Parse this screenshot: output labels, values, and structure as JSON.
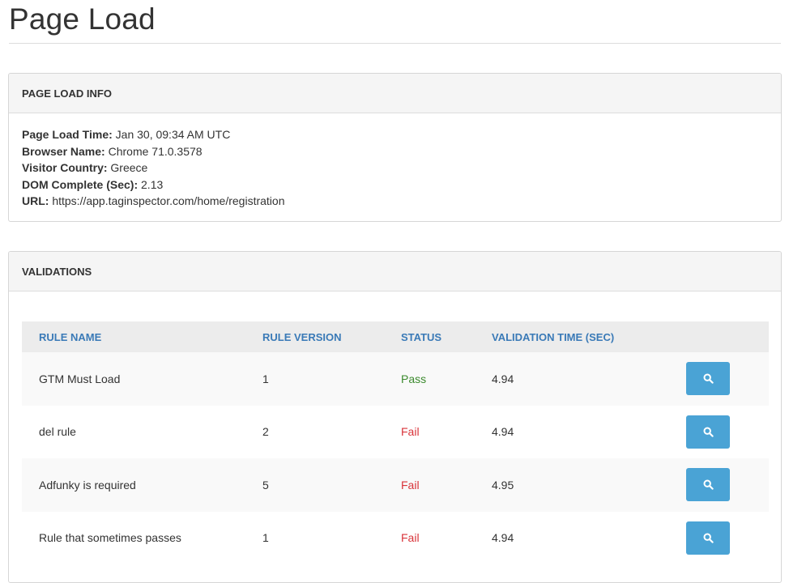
{
  "page": {
    "title": "Page Load"
  },
  "info_panel": {
    "heading": "PAGE LOAD INFO",
    "rows": [
      {
        "label": "Page Load Time:",
        "value": "Jan 30, 09:34 AM UTC"
      },
      {
        "label": "Browser Name:",
        "value": "Chrome 71.0.3578"
      },
      {
        "label": "Visitor Country:",
        "value": "Greece"
      },
      {
        "label": "DOM Complete (Sec):",
        "value": "2.13"
      },
      {
        "label": "URL:",
        "value": "https://app.taginspector.com/home/registration"
      }
    ]
  },
  "validations": {
    "heading": "VALIDATIONS",
    "columns": [
      "RULE NAME",
      "RULE VERSION",
      "STATUS",
      "VALIDATION TIME (SEC)"
    ],
    "rows": [
      {
        "rule_name": "GTM Must Load",
        "rule_version": "1",
        "status": "Pass",
        "validation_time": "4.94",
        "action_icon": "search-icon"
      },
      {
        "rule_name": "del rule",
        "rule_version": "2",
        "status": "Fail",
        "validation_time": "4.94",
        "action_icon": "search-icon"
      },
      {
        "rule_name": "Adfunky is required",
        "rule_version": "5",
        "status": "Fail",
        "validation_time": "4.95",
        "action_icon": "search-icon"
      },
      {
        "rule_name": "Rule that sometimes passes",
        "rule_version": "1",
        "status": "Fail",
        "validation_time": "4.94",
        "action_icon": "search-icon"
      }
    ]
  },
  "colors": {
    "header_link": "#3a7ab7",
    "pass": "#3c8a2e",
    "fail": "#d9343a",
    "button": "#4aa3d5"
  }
}
